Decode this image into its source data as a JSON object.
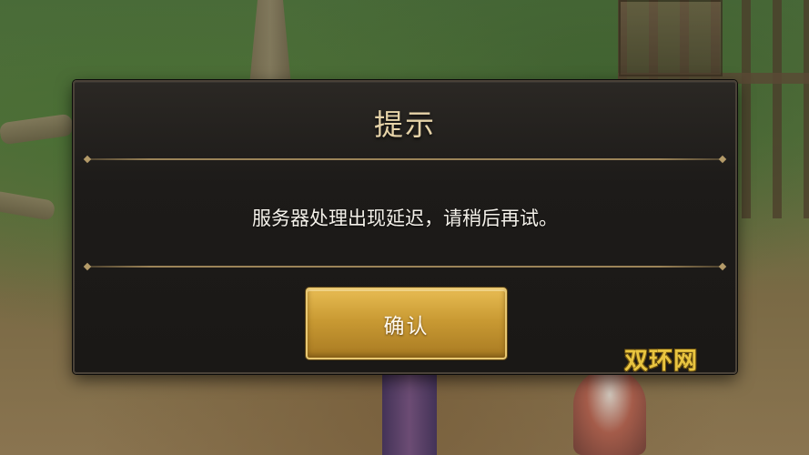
{
  "dialog": {
    "title": "提示",
    "message": "服务器处理出现延迟，请稍后再试。",
    "confirm_label": "确认"
  },
  "watermark": {
    "text": "双环网"
  },
  "colors": {
    "title_gold": "#e6d3a8",
    "button_gold": "#c99a33",
    "dialog_bg": "#1d1b19",
    "watermark_yellow": "#e8c440"
  }
}
